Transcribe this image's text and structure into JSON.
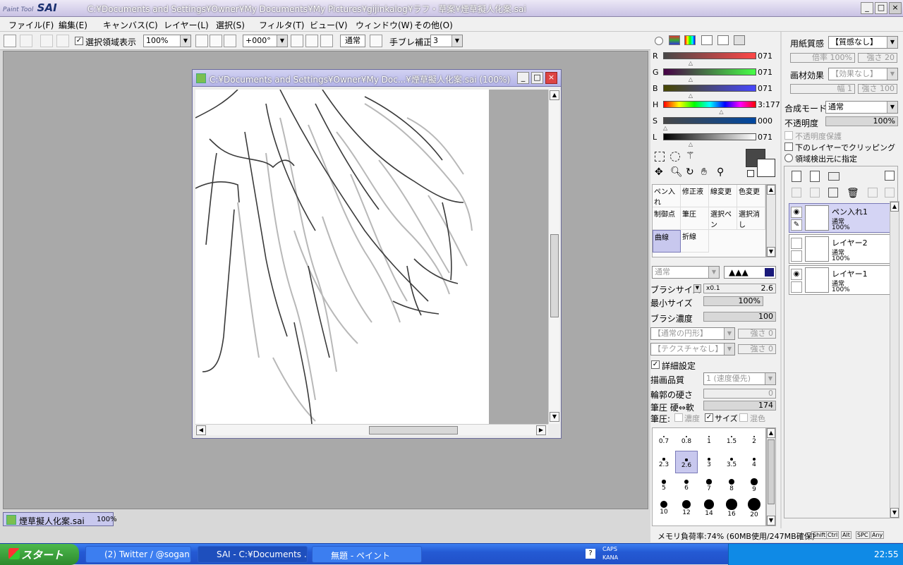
{
  "app": {
    "logo_small": "Paint Tool",
    "logo_big": "SAI",
    "title": "C:¥Documents and Settings¥Owner¥My Documents¥My Pictures¥gijinkalog¥ラフ・草案¥煙草擬人化案.sai"
  },
  "menu": [
    "ファイル(F)",
    "編集(E)",
    "キャンバス(C)",
    "レイヤー(L)",
    "選択(S)",
    "フィルタ(T)",
    "ビュー(V)",
    "ウィンドウ(W)",
    "その他(O)"
  ],
  "toolbar": {
    "selection_visible_label": "選択領域表示",
    "zoom": "100%",
    "rotation": "+000°",
    "mode": "通常",
    "stabilizer_label": "手ブレ補正",
    "stabilizer": "3"
  },
  "document": {
    "title": "C:¥Documents and Settings¥Owner¥My Doc...¥煙草擬人化案.sai (100%)",
    "tab_name": "煙草擬人化案.sai",
    "tab_zoom": "100%"
  },
  "color": {
    "sliders": [
      {
        "label": "R",
        "value": "071",
        "pos": 0.28
      },
      {
        "label": "G",
        "value": "071",
        "pos": 0.28
      },
      {
        "label": "B",
        "value": "071",
        "pos": 0.28
      },
      {
        "label": "H",
        "value": "3:177",
        "pos": 0.62
      },
      {
        "label": "S",
        "value": "000",
        "pos": 0.0
      },
      {
        "label": "L",
        "value": "071",
        "pos": 0.28
      }
    ],
    "primary": "#474747",
    "secondary": "#ffffff"
  },
  "tools": [
    {
      "label": "ペン入れ",
      "selected": false
    },
    {
      "label": "修正液",
      "selected": false
    },
    {
      "label": "線変更",
      "selected": false
    },
    {
      "label": "色変更",
      "selected": false
    },
    {
      "label": "制御点",
      "selected": false
    },
    {
      "label": "筆圧",
      "selected": false
    },
    {
      "label": "選択ペン",
      "selected": false
    },
    {
      "label": "選択消し",
      "selected": false
    },
    {
      "label": "曲線",
      "selected": true
    },
    {
      "label": "折線",
      "selected": false
    }
  ],
  "brush": {
    "mode": "通常",
    "size_label": "ブラシサイズ",
    "size_mult": "x0.1",
    "size": "2.6",
    "min_size_label": "最小サイズ",
    "min_size": "100%",
    "density_label": "ブラシ濃度",
    "density": "100",
    "shape": "【通常の円形】",
    "shape_strength": "強さ 0",
    "texture": "【テクスチャなし】",
    "texture_strength": "強さ 0",
    "detail_label": "詳細設定",
    "quality_label": "描画品質",
    "quality": "1 (速度優先)",
    "edge_label": "輪郭の硬さ",
    "edge": "0",
    "pressure_label": "筆圧 硬⇔軟",
    "pressure": "174",
    "pressure_map_label": "筆圧:",
    "pressure_density": "濃度",
    "pressure_size": "サイズ",
    "pressure_blend": "混色"
  },
  "brush_sizes": [
    "0.7",
    "0.8",
    "1",
    "1.5",
    "2",
    "2.3",
    "2.6",
    "3",
    "3.5",
    "4",
    "5",
    "6",
    "7",
    "8",
    "9",
    "10",
    "12",
    "14",
    "16",
    "20"
  ],
  "paper": {
    "texture_label": "用紙質感",
    "texture": "【質感なし】",
    "scale": "倍率 100%",
    "strength": "強さ 20",
    "effect_label": "画材効果",
    "effect": "【効果なし】",
    "width": "幅 1",
    "effect_strength": "強さ 100"
  },
  "layer_props": {
    "blend_label": "合成モード",
    "blend": "通常",
    "opacity_label": "不透明度",
    "opacity": "100%",
    "preserve_opacity": "不透明度保護",
    "clip_label": "下のレイヤーでクリッピング",
    "detect_label": "領域検出元に指定"
  },
  "layers": [
    {
      "name": "ペン入れ1",
      "mode": "通常",
      "opacity": "100%",
      "selected": true
    },
    {
      "name": "レイヤー2",
      "mode": "通常",
      "opacity": "100%",
      "selected": false
    },
    {
      "name": "レイヤー1",
      "mode": "通常",
      "opacity": "100%",
      "selected": false
    }
  ],
  "status": {
    "memory": "メモリ負荷率:74% (60MB使用/247MB確保)",
    "keys": [
      "Shift",
      "Ctrl",
      "Alt",
      "SPC",
      "Any"
    ]
  },
  "taskbar": {
    "start": "スタート",
    "items": [
      "(2) Twitter / @sogan...",
      "SAI - C:¥Documents ...",
      "無題 - ペイント"
    ],
    "caps": "CAPS",
    "kana": "KANA",
    "clock": "22:55"
  }
}
